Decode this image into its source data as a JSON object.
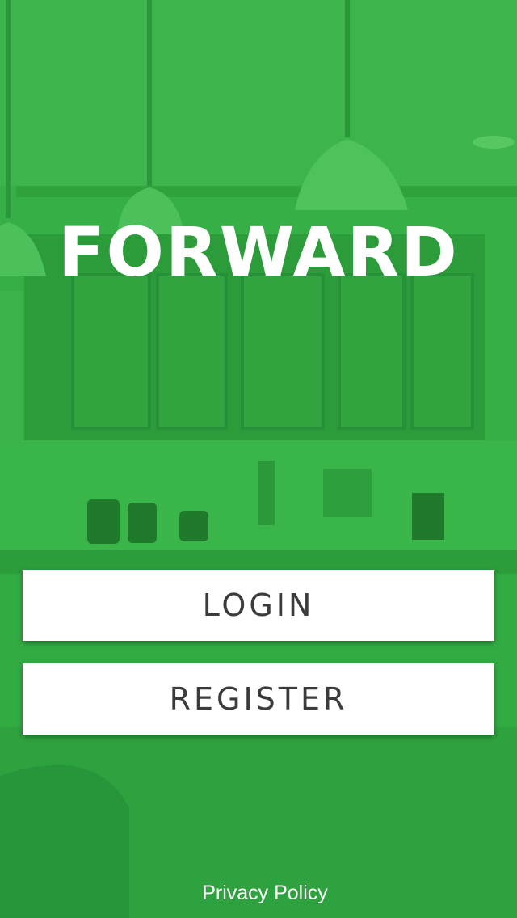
{
  "app": {
    "logo_text": "FORWARD"
  },
  "actions": {
    "login_label": "LOGIN",
    "register_label": "REGISTER"
  },
  "footer": {
    "privacy_label": "Privacy Policy"
  },
  "colors": {
    "brand_green": "#34b044",
    "button_bg": "#ffffff",
    "button_text": "#3b3b3b",
    "logo_text": "#ffffff"
  },
  "background": {
    "description_icon": "kitchen-photo-background"
  }
}
